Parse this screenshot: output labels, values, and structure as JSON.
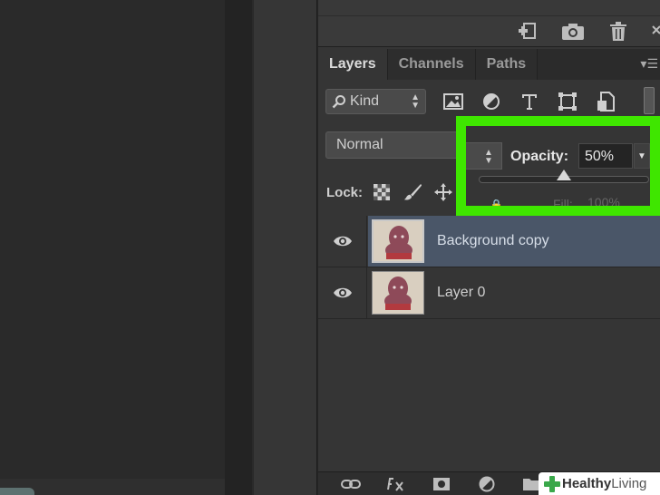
{
  "layers_panel": {
    "tabs": [
      {
        "label": "Layers",
        "active": true
      },
      {
        "label": "Channels",
        "active": false
      },
      {
        "label": "Paths",
        "active": false
      }
    ],
    "filter": {
      "kind_label": "Kind"
    },
    "blend_mode": "Normal",
    "opacity": {
      "label": "Opacity:",
      "value": "50%",
      "level": 0.5
    },
    "lock_label": "Lock:",
    "fill": {
      "label": "Fill:",
      "value": "100%"
    },
    "layers": [
      {
        "name": "Background copy",
        "selected": true,
        "visible": true
      },
      {
        "name": "Layer 0",
        "selected": false,
        "visible": true
      }
    ]
  },
  "watermark": {
    "brand_bold": "Healthy",
    "brand_light": "Living"
  },
  "colors": {
    "highlight": "#3fe600",
    "selected_row": "#4a5668",
    "panel_bg": "#353535"
  }
}
